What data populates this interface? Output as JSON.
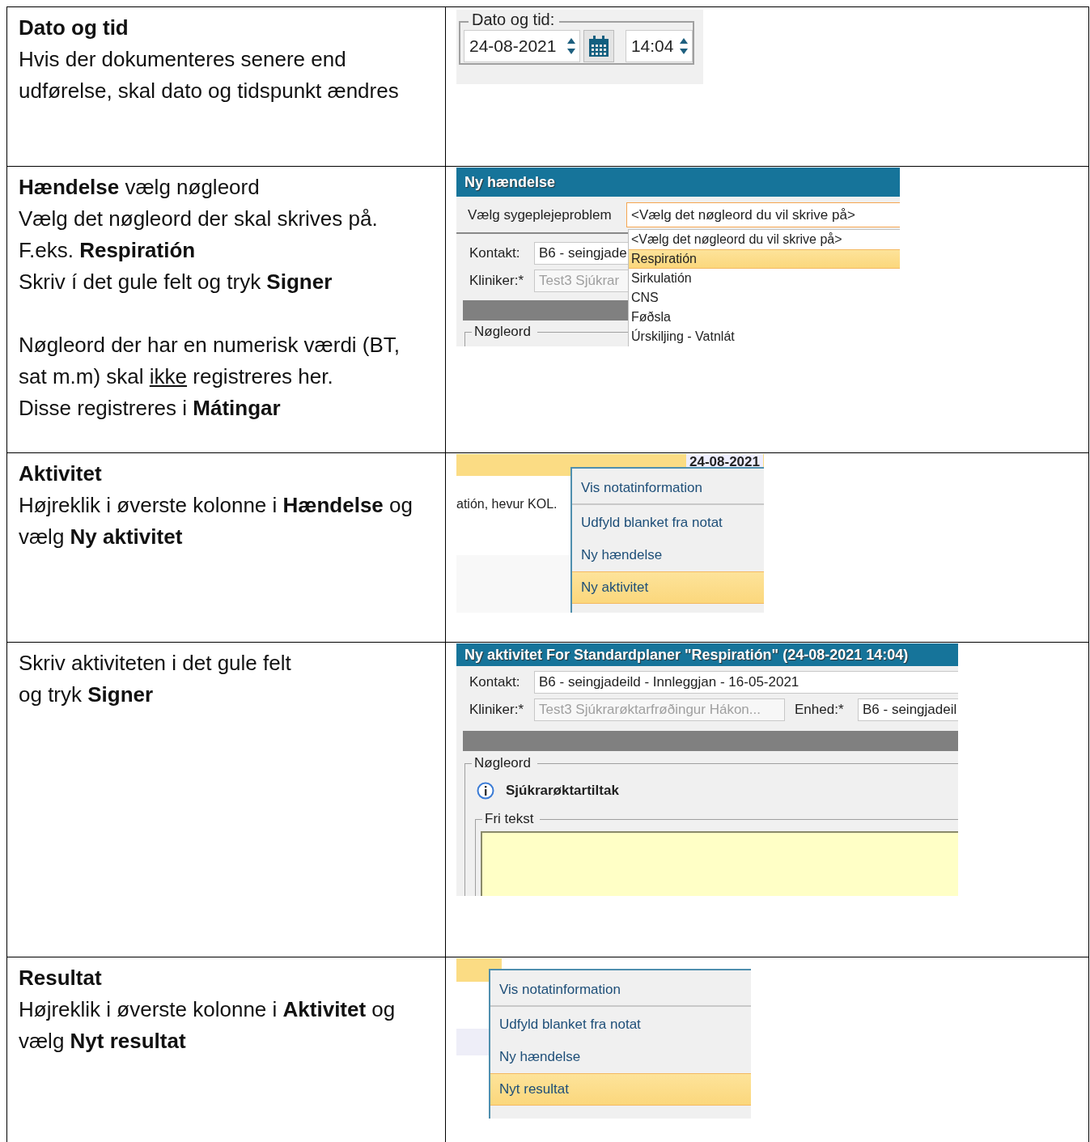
{
  "rows": [
    {
      "heading": "Dato og tid",
      "text": [
        [
          "Hvis der dokumenteres senere end udførelse, skal dato og tidspunkt ændres"
        ]
      ],
      "shot": {
        "kind": "datetime",
        "legend": "Dato og tid:",
        "date": "24-08-2021",
        "time": "14:04"
      }
    },
    {
      "text": [
        [
          "**Hændelse** vælg nøgleord",
          "Vælg det nøgleord der skal skrives på.",
          "F.eks. **Respiratión**",
          "Skriv í det gule felt og tryk **Signer**"
        ],
        [
          {
            "before": "Nøgleord der har en numerisk værdi (BT, sat m.m) skal ",
            "underlined": "ikke",
            "after": " registreres her."
          },
          "Disse registreres i **Mátingar**"
        ]
      ],
      "shot": {
        "kind": "event_dialog",
        "title": "Ny hændelse",
        "problem_label": "Vælg sygeplejeproblem",
        "problem_value": "<Vælg det nøgleord du vil skrive på>",
        "contact_label": "Kontakt:",
        "contact_value": "B6 - seingjade",
        "clinician_label": "Kliniker:*",
        "clinician_value": "Test3 Sjúkrar",
        "keyword_legend": "Nøgleord",
        "options": [
          {
            "label": "<Vælg det nøgleord du vil skrive på>",
            "selected": false
          },
          {
            "label": "Respiratión",
            "selected": true
          },
          {
            "label": "Sirkulatión",
            "selected": false
          },
          {
            "label": "CNS",
            "selected": false
          },
          {
            "label": "Føðsla",
            "selected": false
          },
          {
            "label": "Úrskiljing - Vatnlát",
            "selected": false
          }
        ]
      }
    },
    {
      "heading": "Aktivitet",
      "text": [
        [
          "Højreklik i øverste kolonne i **Hændelse** og vælg **Ny aktivitet**"
        ]
      ],
      "shot": {
        "kind": "context_menu",
        "date": "24-08-2021",
        "note": "atión, hevur KOL.",
        "items": [
          {
            "label": "Vis notatinformation",
            "selected": false,
            "separator_after": true
          },
          {
            "label": "Udfyld blanket fra notat",
            "selected": false,
            "separator_after": false
          },
          {
            "label": "Ny hændelse",
            "selected": false,
            "separator_after": false
          },
          {
            "label": "Ny aktivitet",
            "selected": true,
            "separator_after": false
          }
        ]
      }
    },
    {
      "text": [
        [
          "Skriv aktiviteten i det gule felt",
          "og tryk **Signer**"
        ]
      ],
      "shot": {
        "kind": "activity_dialog",
        "title": "Ny aktivitet For Standardplaner \"Respiratión\" (24-08-2021 14:04)",
        "contact_label": "Kontakt:",
        "contact_value": "B6 - seingjadeild - Innleggjan -  16-05-2021",
        "clinician_label": "Kliniker:*",
        "clinician_value": "Test3 Sjúkrarøktarfrøðingur Hákon...",
        "unit_label": "Enhed:*",
        "unit_value": "B6 - seingjadeil",
        "keyword_legend": "Nøgleord",
        "info": "Sjúkrarøktartiltak",
        "free_text_legend": "Fri tekst"
      }
    },
    {
      "heading": "Resultat",
      "text": [
        [
          "Højreklik i øverste kolonne i **Aktivitet** og vælg **Nyt resultat**"
        ]
      ],
      "shot": {
        "kind": "context_menu",
        "items": [
          {
            "label": "Vis notatinformation",
            "selected": false,
            "separator_after": true
          },
          {
            "label": "Udfyld blanket fra notat",
            "selected": false,
            "separator_after": false
          },
          {
            "label": "Ny hændelse",
            "selected": false,
            "separator_after": false
          },
          {
            "label": "Nyt resultat",
            "selected": true,
            "separator_after": false
          }
        ]
      }
    }
  ]
}
